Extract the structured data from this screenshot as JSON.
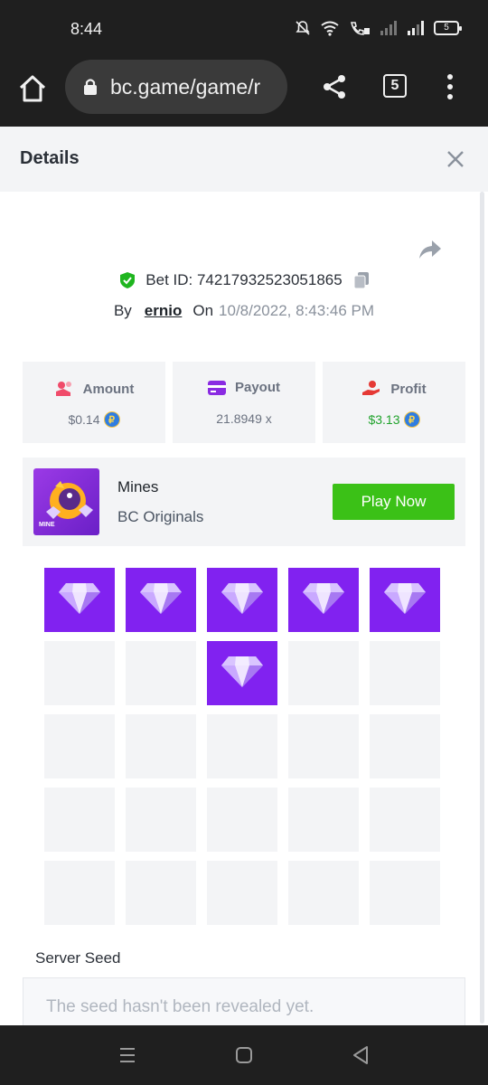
{
  "status_bar": {
    "time": "8:44",
    "battery": "5",
    "icons": [
      "mute-icon",
      "wifi-icon",
      "wifi-calling-icon",
      "signal-icon",
      "signal-icon",
      "battery-icon"
    ]
  },
  "browser": {
    "url": "bc.game/game/r",
    "tab_count": "5"
  },
  "panel": {
    "title": "Details"
  },
  "bet": {
    "id_label": "Bet ID: 74217932523051865",
    "by_label": "By",
    "user": "ernio",
    "on_label": "On",
    "datetime": "10/8/2022, 8:43:46 PM"
  },
  "stats": {
    "amount": {
      "label": "Amount",
      "value": "$0.14"
    },
    "payout": {
      "label": "Payout",
      "value": "21.8949 x"
    },
    "profit": {
      "label": "Profit",
      "value": "$3.13"
    }
  },
  "game": {
    "name": "Mines",
    "provider": "BC Originals",
    "thumb_tag": "MINE",
    "play_label": "Play Now"
  },
  "board": {
    "columns": 5,
    "rows": 5,
    "gems": [
      0,
      1,
      2,
      3,
      4,
      7
    ]
  },
  "seed": {
    "label": "Server Seed",
    "placeholder": "The seed hasn't been revealed yet."
  },
  "colors": {
    "gem_tile": "#8122f0",
    "empty_tile": "#f3f4f6",
    "play_button": "#3bc117",
    "profit": "#22a32e"
  }
}
